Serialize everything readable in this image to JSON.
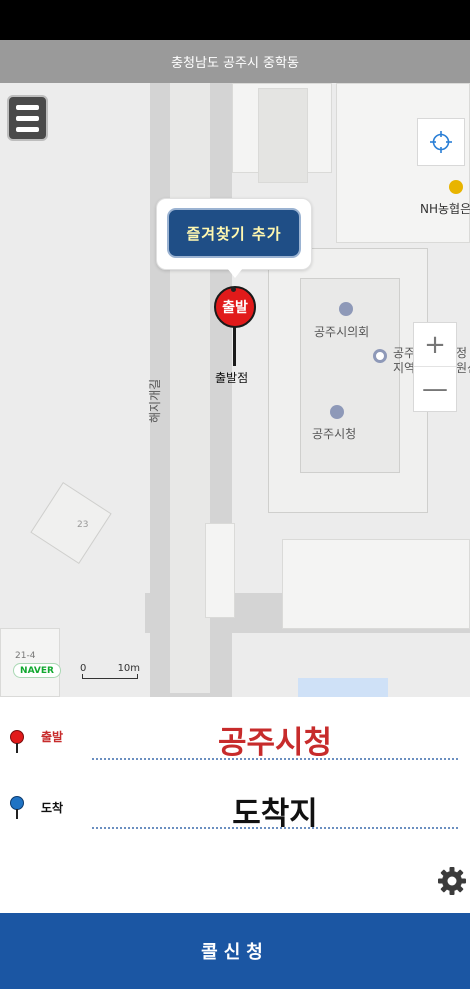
{
  "location_bar": {
    "address": "충청남도 공주시 중학동"
  },
  "map": {
    "labels": {
      "bank": "NH농협은",
      "council": "공주시의회",
      "cityhall": "공주시청",
      "road": "해지개길",
      "center_partial_1": "공주",
      "center_partial_2": "지역",
      "edge_partial_1": "정",
      "edge_partial_2": "원신",
      "lot_23": "23",
      "lot_214": "21-4"
    },
    "zoom_in": "+",
    "zoom_out": "—",
    "naver_logo": "NAVER",
    "scale_min": "0",
    "scale_max": "10m"
  },
  "callout": {
    "favorite_label": "즐겨찾기 추가"
  },
  "pin": {
    "badge": "출발",
    "caption": "출발점"
  },
  "route": {
    "departure": {
      "label": "출발",
      "value": "공주시청"
    },
    "arrival": {
      "label": "도착",
      "value": "도착지"
    }
  },
  "call_button": {
    "label": "콜신청"
  },
  "icons": {
    "menu": "menu-icon",
    "locate": "crosshair-icon",
    "settings": "gear-icon",
    "poi": "building-icon"
  },
  "colors": {
    "primary": "#1b56a3",
    "departure": "#c72b2b",
    "arrival": "#1f73c4",
    "pin": "#e11a1a"
  }
}
